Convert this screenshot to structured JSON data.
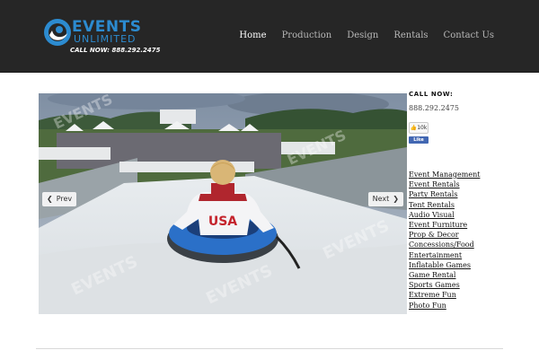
{
  "brand": {
    "name": "EVENTS",
    "subname": "UNLIMITED",
    "call_line": "CALL NOW: 888.292.2475"
  },
  "nav": {
    "items": [
      {
        "label": "Home",
        "active": true
      },
      {
        "label": "Production",
        "active": false
      },
      {
        "label": "Design",
        "active": false
      },
      {
        "label": "Rentals",
        "active": false
      },
      {
        "label": "Contact Us",
        "active": false
      }
    ]
  },
  "slider": {
    "prev_label": "Prev",
    "next_label": "Next",
    "jersey_text": "USA",
    "watermark": "EVENTS"
  },
  "sidebar": {
    "call_label": "CALL NOW:",
    "phone": "888.292.2475",
    "like_count": "10k",
    "like_label": "Like"
  },
  "links": [
    "Event Management",
    "Event Rentals",
    "Party Rentals",
    "Tent Rentals",
    "Audio Visual",
    "Event Furniture",
    "Prop & Decor",
    "Concessions/Food",
    "Entertainment",
    "Inflatable Games",
    "Game Rental",
    "Sports Games",
    "Extreme Fun",
    "Photo Fun"
  ],
  "colors": {
    "header_bg": "#262626",
    "brand_blue": "#2c8bd0",
    "facebook_blue": "#4267b2"
  }
}
